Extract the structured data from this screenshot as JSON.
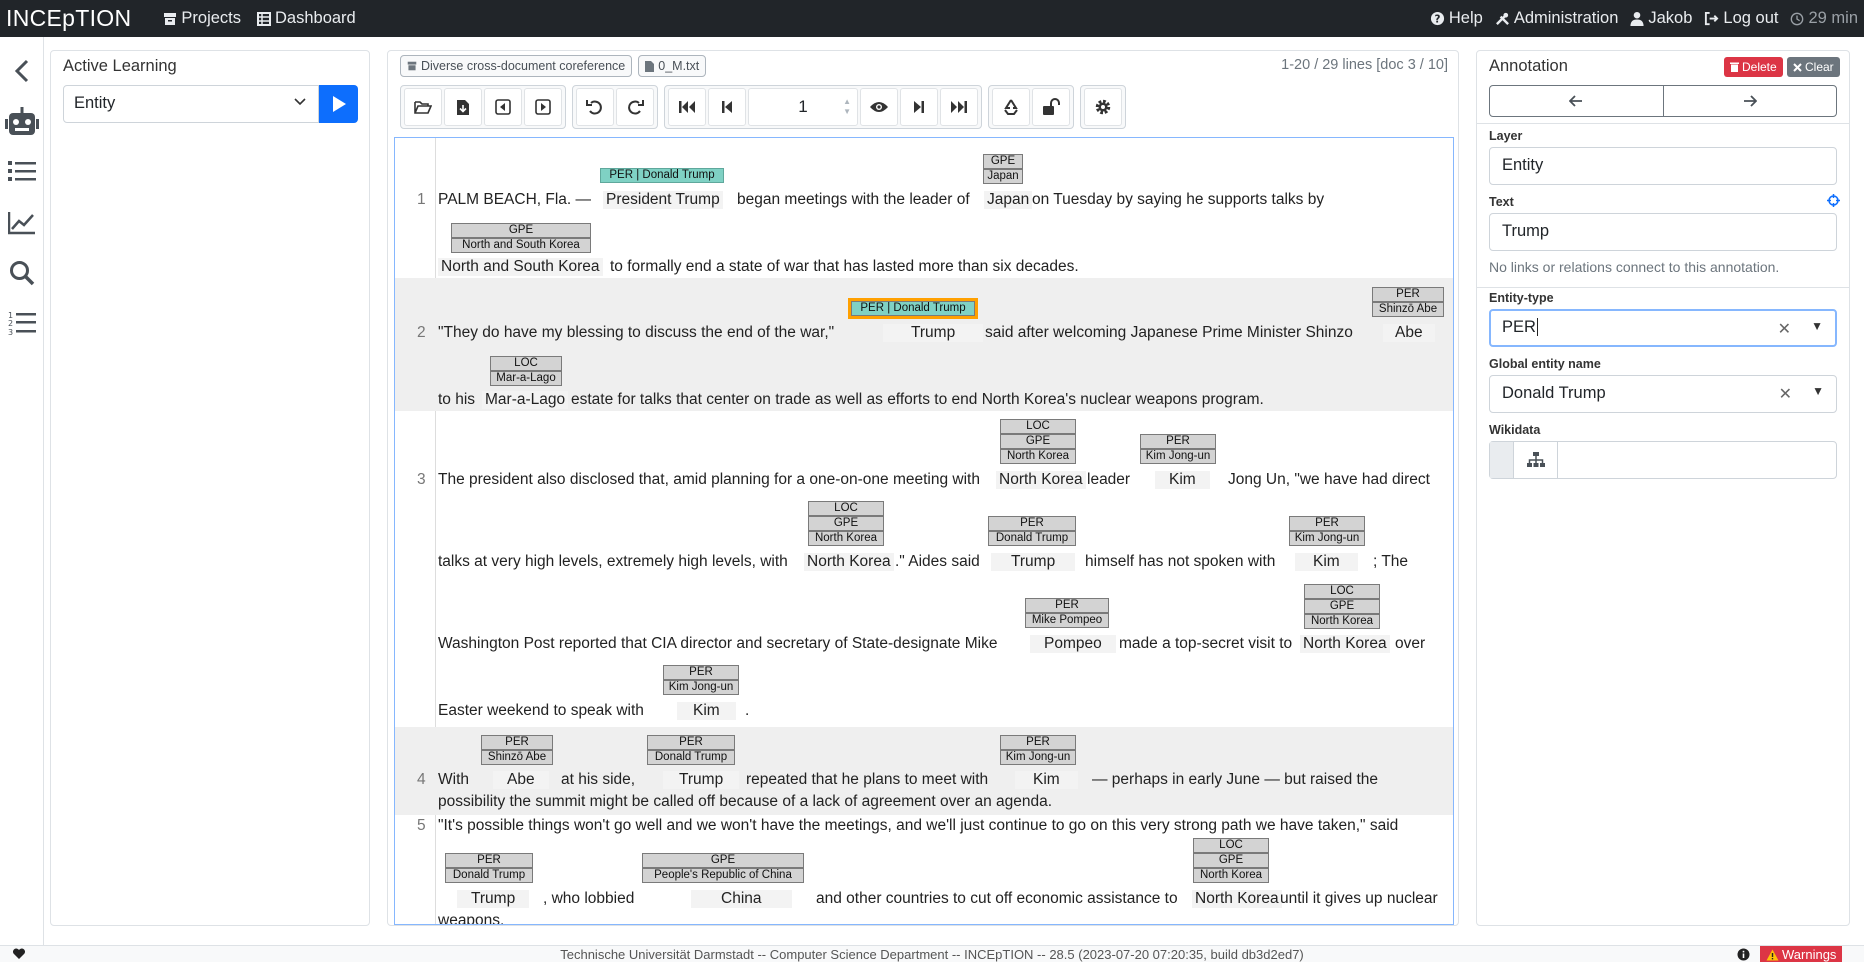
{
  "navbar": {
    "brand": "INCEpTION",
    "left": [
      {
        "label": "Projects",
        "icon": "archive-icon"
      },
      {
        "label": "Dashboard",
        "icon": "table-icon"
      }
    ],
    "right": [
      {
        "label": "Help",
        "icon": "question-circle-icon"
      },
      {
        "label": "Administration",
        "icon": "tools-icon"
      },
      {
        "label": "Jakob",
        "icon": "user-icon"
      },
      {
        "label": "Log out",
        "icon": "sign-out-icon"
      },
      {
        "label": "29 min",
        "icon": "clock-icon"
      }
    ]
  },
  "rail": [
    "chevron-left-icon",
    "robot-icon",
    "list-icon",
    "chart-line-icon",
    "search-icon",
    "ordered-list-icon"
  ],
  "active_learning": {
    "title": "Active Learning",
    "layer_select": "Entity"
  },
  "document": {
    "project": "Diverse cross-document coreference",
    "file": "0_M.txt",
    "info": "1-20 / 29 lines [doc 3 / 10]",
    "page": "1",
    "lines": [
      {
        "n": "1",
        "row1": [
          "PALM BEACH, Fla. —",
          "President Trump",
          "began meetings with the leader of",
          "Japan",
          "on Tuesday by saying he supports talks by"
        ],
        "row2": [
          "North and South Korea",
          "to formally end a state of war that has lasted more than six decades."
        ]
      },
      {
        "n": "2",
        "row1": [
          "\"They do have my blessing to discuss the end of the war,\"",
          "Trump",
          "said after welcoming Japanese Prime Minister Shinzo",
          "Abe"
        ],
        "row2": [
          "to his",
          "Mar-a-Lago",
          "estate for talks that center on trade as well as efforts to end North Korea's nuclear weapons program."
        ]
      },
      {
        "n": "3",
        "row1": [
          "The president also disclosed that, amid planning for a one-on-one meeting with",
          "North Korea",
          "leader",
          "Kim",
          "Jong Un, \"we have had direct"
        ],
        "row2": [
          "talks at very high levels, extremely high levels, with",
          "North Korea",
          ".\" Aides said",
          "Trump",
          "himself has not spoken with",
          "Kim",
          "; The"
        ],
        "row3": [
          "Washington Post reported that CIA director and secretary of State-designate Mike",
          "Pompeo",
          "made a top-secret visit to",
          "North Korea",
          "over"
        ],
        "row4": [
          "Easter weekend to speak with",
          "Kim",
          "."
        ]
      },
      {
        "n": "4",
        "row1": [
          "With",
          "Abe",
          "at his side,",
          "Trump",
          "repeated that he plans to meet with",
          "Kim",
          "— perhaps in early June — but raised the"
        ],
        "row2": [
          "possibility the summit might be called off because of a lack of agreement over an agenda."
        ]
      },
      {
        "n": "5",
        "row1": [
          "\"It's possible things won't go well and we won't have the meetings, and we'll just continue to go on this very strong path we have taken,\" said"
        ],
        "row2": [
          "Trump",
          ", who lobbied",
          "China",
          "and other countries to cut off economic assistance to",
          "North Korea",
          "until it gives up nuclear"
        ],
        "row3": [
          "weapons."
        ]
      }
    ],
    "labels": {
      "per_trump_1": "PER | Donald Trump",
      "gpe": "GPE",
      "japan": "Japan",
      "north_south_korea": "North and South Korea",
      "per_trump_sel": "PER | Donald Trump",
      "per": "PER",
      "shinzo_abe": "Shinzō Abe",
      "loc": "LOC",
      "mar_a_lago": "Mar-a-Lago",
      "north_korea": "North Korea",
      "kim_jong_un": "Kim Jong-un",
      "donald_trump": "Donald Trump",
      "mike_pompeo": "Mike Pompeo",
      "china": "People's Republic of China"
    }
  },
  "annotation": {
    "title": "Annotation",
    "delete": "Delete",
    "clear": "Clear",
    "layer_label": "Layer",
    "layer_value": "Entity",
    "text_label": "Text",
    "text_value": "Trump",
    "note": "No links or relations connect to this annotation.",
    "entity_type_label": "Entity-type",
    "entity_type_value": "PER",
    "global_name_label": "Global entity name",
    "global_name_value": "Donald Trump",
    "wikidata_label": "Wikidata"
  },
  "footer": {
    "text": "Technische Universität Darmstadt -- Computer Science Department -- INCEpTION -- 28.5 (2023-07-20 07:20:35, build db3d2ed7)",
    "warnings": "Warnings"
  },
  "colors": {
    "navbar": "#212529",
    "primary": "#0d6efd",
    "danger": "#dc3545",
    "entity_teal": "#7fd1c4",
    "selection": "#ffa000"
  }
}
